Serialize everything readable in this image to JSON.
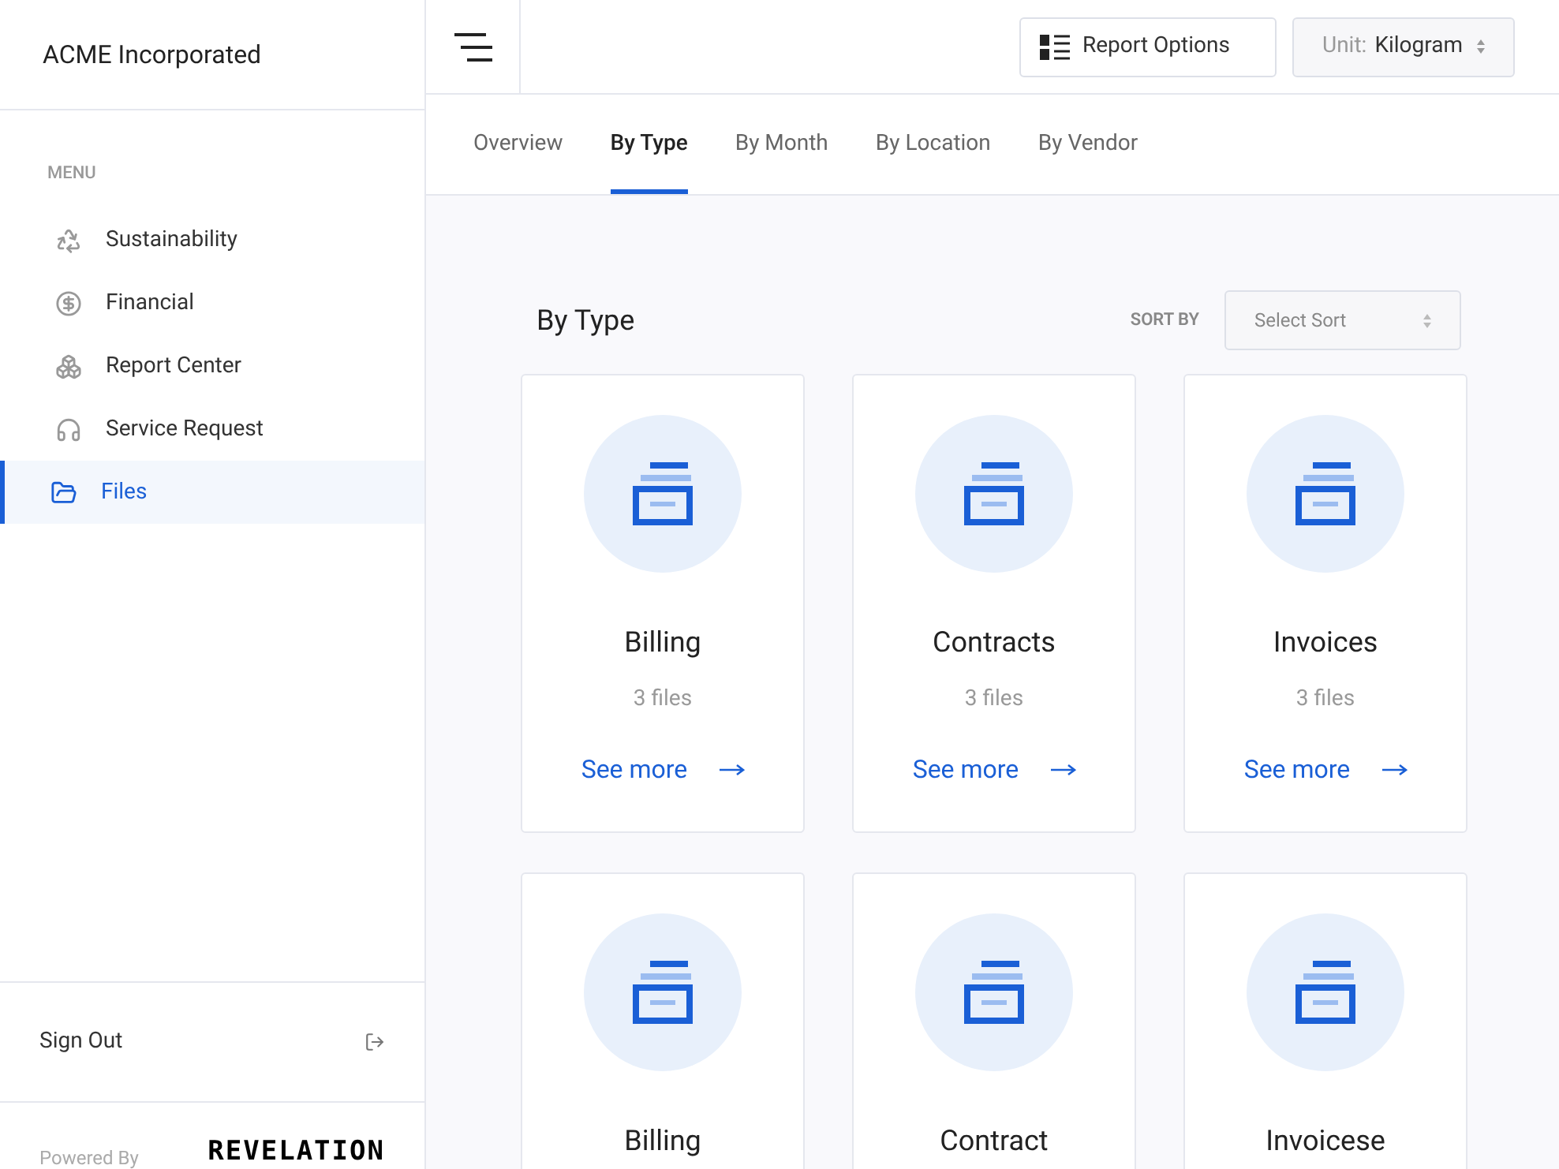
{
  "sidebar": {
    "company": "ACME Incorporated",
    "menu_label": "MENU",
    "items": [
      {
        "label": "Sustainability",
        "kind": "recycle",
        "selected": false
      },
      {
        "label": "Financial",
        "kind": "dollar",
        "selected": false
      },
      {
        "label": "Report Center",
        "kind": "boxes",
        "selected": false
      },
      {
        "label": "Service Request",
        "kind": "headset",
        "selected": false
      },
      {
        "label": "Files",
        "kind": "folder",
        "selected": true
      }
    ],
    "sign_out": "Sign Out",
    "powered_by": "Powered By",
    "brand": "REVELATION"
  },
  "header": {
    "report_options": "Report Options",
    "unit_label": "Unit:",
    "unit_value": "Kilogram"
  },
  "tabs": [
    {
      "label": "Overview",
      "selected": false
    },
    {
      "label": "By Type",
      "selected": true
    },
    {
      "label": "By Month",
      "selected": false
    },
    {
      "label": "By Location",
      "selected": false
    },
    {
      "label": "By Vendor",
      "selected": false
    }
  ],
  "section": {
    "title": "By Type",
    "sort_label": "SORT BY",
    "sort_placeholder": "Select Sort"
  },
  "cards": [
    {
      "title": "Billing",
      "count": "3 files",
      "link": "See more"
    },
    {
      "title": "Contracts",
      "count": "3 files",
      "link": "See more"
    },
    {
      "title": "Invoices",
      "count": "3 files",
      "link": "See more"
    },
    {
      "title": "Billing"
    },
    {
      "title": "Contract"
    },
    {
      "title": "Invoicese"
    }
  ]
}
